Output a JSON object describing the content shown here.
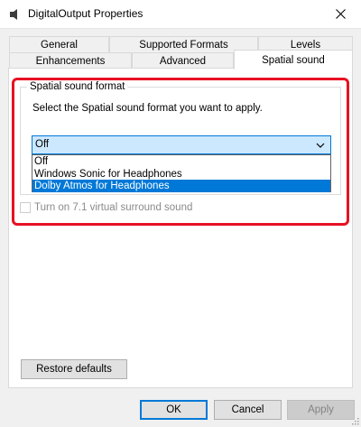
{
  "window": {
    "title": "DigitalOutput Properties",
    "close_glyph": "✕"
  },
  "tabs_top_row": [
    {
      "label": "General"
    },
    {
      "label": "Supported Formats"
    },
    {
      "label": "Levels"
    }
  ],
  "tabs_bottom_row": [
    {
      "label": "Enhancements"
    },
    {
      "label": "Advanced"
    },
    {
      "label": "Spatial sound",
      "active": true
    }
  ],
  "spatial": {
    "group_title": "Spatial sound format",
    "prompt": "Select the Spatial sound format you want to apply.",
    "selected_value": "Off",
    "options": [
      "Off",
      "Windows Sonic for Headphones",
      "Dolby Atmos for Headphones"
    ],
    "highlighted_option": "Dolby Atmos for Headphones",
    "checkbox_label": "Turn on 7.1 virtual surround sound",
    "checkbox_checked": false,
    "checkbox_enabled": false
  },
  "buttons": {
    "restore_defaults": "Restore defaults",
    "ok": "OK",
    "cancel": "Cancel",
    "apply": "Apply"
  },
  "colors": {
    "accent": "#0078d7",
    "highlight_box": "#e81123",
    "selection_bg": "#cce8ff"
  },
  "icons": {
    "title": "speaker-icon",
    "close": "close-icon",
    "chevron": "chevron-down-icon",
    "grip": "resize-grip-icon"
  }
}
